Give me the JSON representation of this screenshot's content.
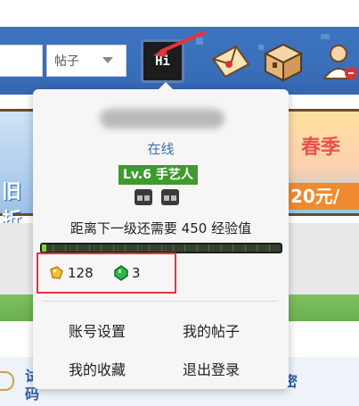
{
  "header": {
    "search_select_value": "帖子",
    "avatar_text": "Hi"
  },
  "banners": {
    "left_text": "旧折",
    "right_title": "春季",
    "right_promo": "20元/"
  },
  "bottom": {
    "left_text": "试码",
    "right_text": "密"
  },
  "user_menu": {
    "status": "在线",
    "level_badge": "Lv.6 手艺人",
    "exp_text": "距离下一级还需要 450 经验值",
    "exp_progress": 0.02,
    "currencies": [
      {
        "icon": "gold-nugget-icon",
        "value": "128",
        "color": "#f2c230"
      },
      {
        "icon": "emerald-icon",
        "value": "3",
        "color": "#2fb34a"
      }
    ],
    "menu": {
      "account_settings": "账号设置",
      "my_posts": "我的帖子",
      "my_favorites": "我的收藏",
      "logout": "退出登录"
    }
  },
  "colors": {
    "header_blue": "#3a6fba",
    "level_green": "#3f9a2d",
    "highlight_red": "#e5343a",
    "online_blue": "#3e6fa8"
  }
}
